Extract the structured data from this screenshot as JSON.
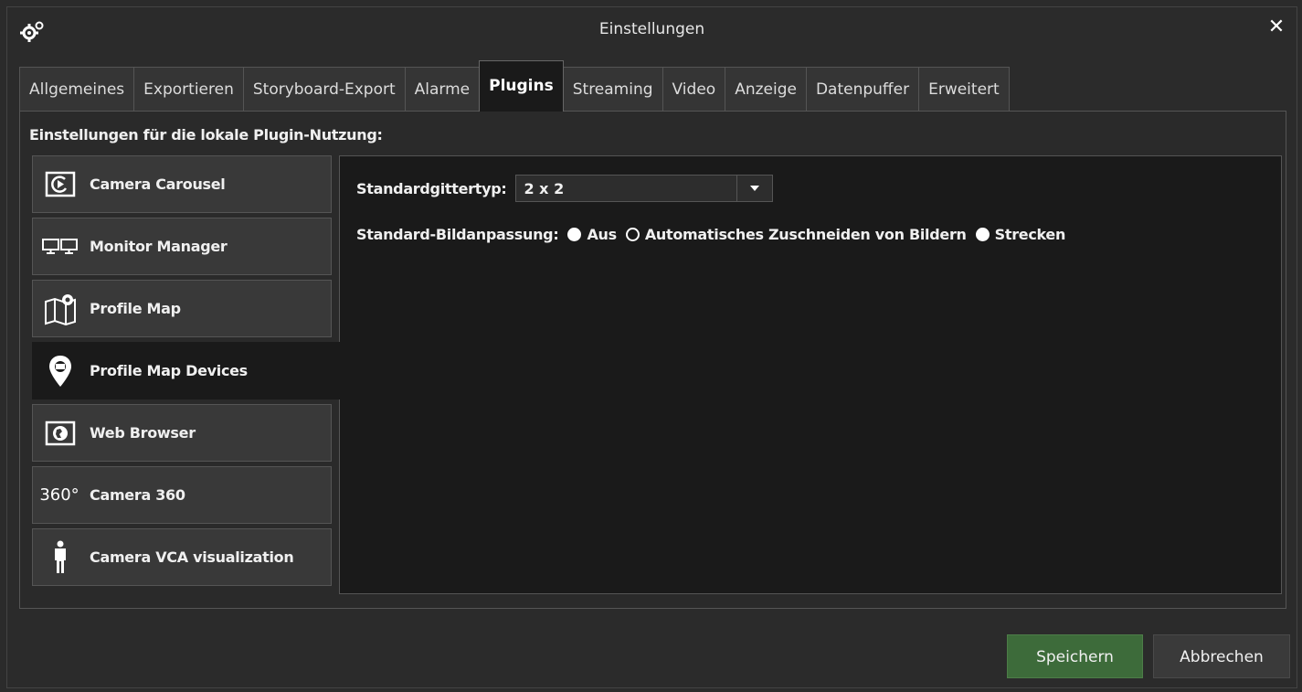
{
  "window": {
    "title": "Einstellungen",
    "close_label": "✕",
    "icon": "gears-icon"
  },
  "tabs": [
    {
      "label": "Allgemeines",
      "active": false
    },
    {
      "label": "Exportieren",
      "active": false
    },
    {
      "label": "Storyboard-Export",
      "active": false
    },
    {
      "label": "Alarme",
      "active": false
    },
    {
      "label": "Plugins",
      "active": true
    },
    {
      "label": "Streaming",
      "active": false
    },
    {
      "label": "Video",
      "active": false
    },
    {
      "label": "Anzeige",
      "active": false
    },
    {
      "label": "Datenpuffer",
      "active": false
    },
    {
      "label": "Erweitert",
      "active": false
    }
  ],
  "panel": {
    "heading": "Einstellungen für die lokale Plugin-Nutzung:"
  },
  "plugins": [
    {
      "label": "Camera Carousel",
      "icon": "carousel-icon",
      "active": false
    },
    {
      "label": "Monitor Manager",
      "icon": "monitors-icon",
      "active": false
    },
    {
      "label": "Profile Map",
      "icon": "map-icon",
      "active": false
    },
    {
      "label": "Profile Map Devices",
      "icon": "map-pin-icon",
      "active": true
    },
    {
      "label": "Web Browser",
      "icon": "globe-icon",
      "active": false
    },
    {
      "label": "Camera 360",
      "icon": "360-icon",
      "active": false,
      "icon_text": "360°"
    },
    {
      "label": "Camera VCA visualization",
      "icon": "person-icon",
      "active": false
    }
  ],
  "settings": {
    "grid_type_label": "Standardgittertyp:",
    "grid_type_value": "2 x 2",
    "fit_label": "Standard-Bildanpassung:",
    "fit_options": [
      {
        "label": "Aus",
        "selected": false
      },
      {
        "label": "Automatisches Zuschneiden von Bildern",
        "selected": true
      },
      {
        "label": "Strecken",
        "selected": false
      }
    ]
  },
  "buttons": {
    "save": "Speichern",
    "cancel": "Abbrechen"
  },
  "colors": {
    "background": "#2b2b2b",
    "content": "#1a1a1a",
    "save_button": "#3d6b3a"
  }
}
